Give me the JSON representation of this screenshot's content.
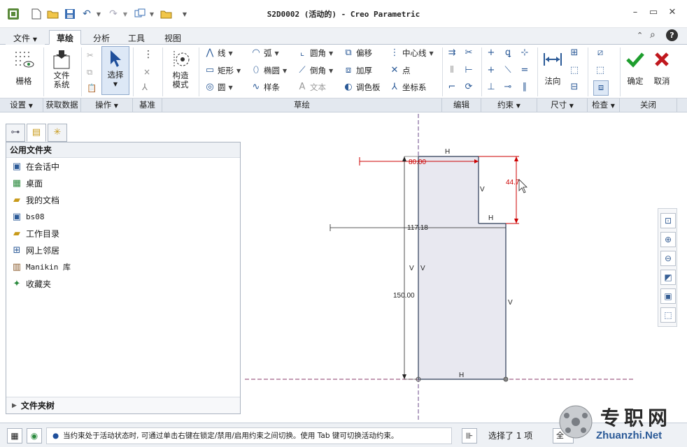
{
  "window": {
    "title": "S2D0002 (活动的) - Creo Parametric"
  },
  "tabs": [
    {
      "label": "文件"
    },
    {
      "label": "草绘"
    },
    {
      "label": "分析"
    },
    {
      "label": "工具"
    },
    {
      "label": "视图"
    }
  ],
  "ribbon": {
    "grid_label": "栅格",
    "file_system_label_1": "文件",
    "file_system_label_2": "系统",
    "select_label": "选择",
    "construction_label_1": "构造",
    "construction_label_2": "模式",
    "line": "线",
    "rectangle": "矩形",
    "circle": "圆",
    "arc": "弧",
    "ellipse": "椭圆",
    "spline": "样条",
    "fillet": "圆角",
    "chamfer": "倒角",
    "text": "文本",
    "offset": "偏移",
    "thicken": "加厚",
    "palette": "调色板",
    "centerline": "中心线",
    "point": "点",
    "coord_sys": "坐标系",
    "normal": "法向",
    "ok": "确定",
    "cancel": "取消"
  },
  "groups": [
    "设置",
    "获取数据",
    "操作",
    "基准",
    "草绘",
    "编辑",
    "约束",
    "尺寸",
    "检查",
    "关闭"
  ],
  "navigator": {
    "header": "公用文件夹",
    "items": [
      {
        "label": "在会话中"
      },
      {
        "label": "桌面"
      },
      {
        "label": "我的文档"
      },
      {
        "label": "bs08"
      },
      {
        "label": "工作目录"
      },
      {
        "label": "网上邻居"
      },
      {
        "label": "Manikin 库"
      },
      {
        "label": "收藏夹"
      }
    ],
    "folder_tree": "文件夹树"
  },
  "sketch": {
    "dim_top_width": "80.00",
    "dim_step_height": "44.7",
    "dim_mid_width": "117.18",
    "dim_total_height": "150.00",
    "constraint_h": "H",
    "constraint_v": "V"
  },
  "status": {
    "message": "当约束处于活动状态时, 可通过单击右键在锁定/禁用/启用约束之间切换。使用 Tab 键可切换活动约束。",
    "selection": "选择了 1 项",
    "filter": "全"
  },
  "watermark": {
    "cn": "专职网",
    "en": "Zhuanzhi.Net"
  },
  "colors": {
    "dimension": "#cc0000",
    "sketch_line": "#2b3a55",
    "fill": "#e8e8f0",
    "centerline": "#8a3a6a",
    "accept": "#1e9e2e",
    "cancel": "#c0181e"
  }
}
